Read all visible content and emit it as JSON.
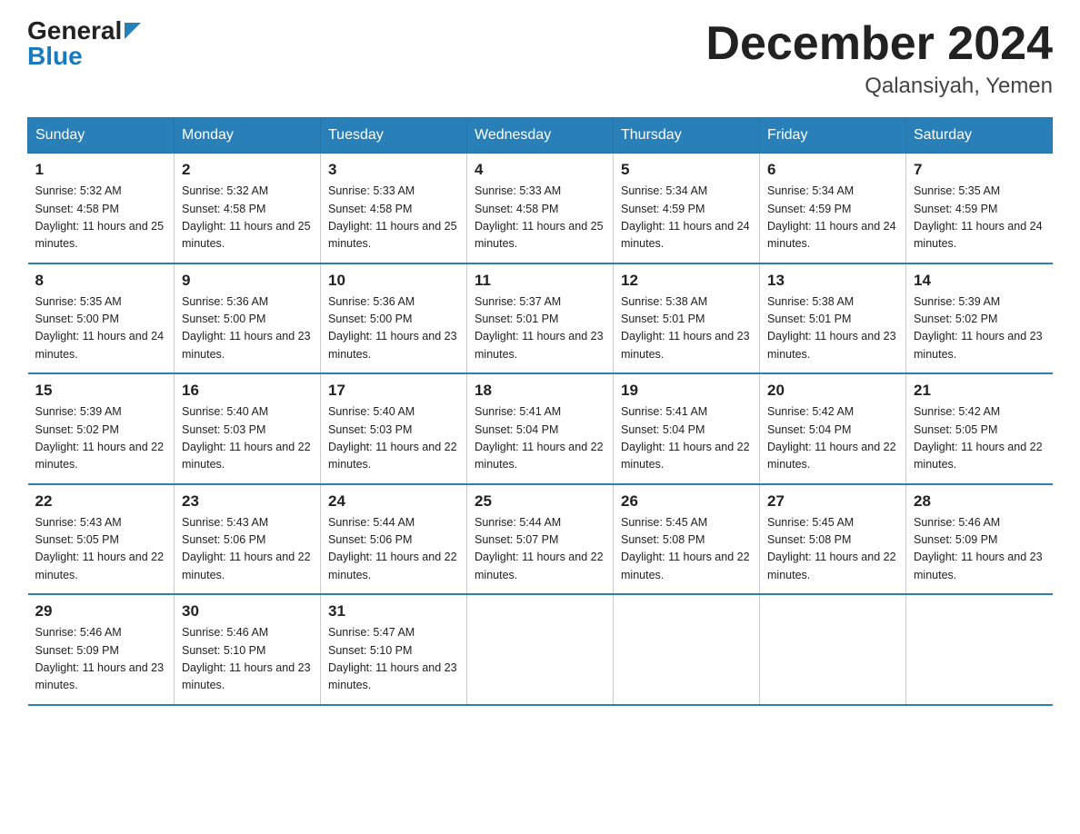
{
  "header": {
    "logo_general": "General",
    "logo_blue": "Blue",
    "month_title": "December 2024",
    "location": "Qalansiyah, Yemen"
  },
  "days_of_week": [
    "Sunday",
    "Monday",
    "Tuesday",
    "Wednesday",
    "Thursday",
    "Friday",
    "Saturday"
  ],
  "weeks": [
    [
      {
        "day": "1",
        "sunrise": "5:32 AM",
        "sunset": "4:58 PM",
        "daylight": "11 hours and 25 minutes."
      },
      {
        "day": "2",
        "sunrise": "5:32 AM",
        "sunset": "4:58 PM",
        "daylight": "11 hours and 25 minutes."
      },
      {
        "day": "3",
        "sunrise": "5:33 AM",
        "sunset": "4:58 PM",
        "daylight": "11 hours and 25 minutes."
      },
      {
        "day": "4",
        "sunrise": "5:33 AM",
        "sunset": "4:58 PM",
        "daylight": "11 hours and 25 minutes."
      },
      {
        "day": "5",
        "sunrise": "5:34 AM",
        "sunset": "4:59 PM",
        "daylight": "11 hours and 24 minutes."
      },
      {
        "day": "6",
        "sunrise": "5:34 AM",
        "sunset": "4:59 PM",
        "daylight": "11 hours and 24 minutes."
      },
      {
        "day": "7",
        "sunrise": "5:35 AM",
        "sunset": "4:59 PM",
        "daylight": "11 hours and 24 minutes."
      }
    ],
    [
      {
        "day": "8",
        "sunrise": "5:35 AM",
        "sunset": "5:00 PM",
        "daylight": "11 hours and 24 minutes."
      },
      {
        "day": "9",
        "sunrise": "5:36 AM",
        "sunset": "5:00 PM",
        "daylight": "11 hours and 23 minutes."
      },
      {
        "day": "10",
        "sunrise": "5:36 AM",
        "sunset": "5:00 PM",
        "daylight": "11 hours and 23 minutes."
      },
      {
        "day": "11",
        "sunrise": "5:37 AM",
        "sunset": "5:01 PM",
        "daylight": "11 hours and 23 minutes."
      },
      {
        "day": "12",
        "sunrise": "5:38 AM",
        "sunset": "5:01 PM",
        "daylight": "11 hours and 23 minutes."
      },
      {
        "day": "13",
        "sunrise": "5:38 AM",
        "sunset": "5:01 PM",
        "daylight": "11 hours and 23 minutes."
      },
      {
        "day": "14",
        "sunrise": "5:39 AM",
        "sunset": "5:02 PM",
        "daylight": "11 hours and 23 minutes."
      }
    ],
    [
      {
        "day": "15",
        "sunrise": "5:39 AM",
        "sunset": "5:02 PM",
        "daylight": "11 hours and 22 minutes."
      },
      {
        "day": "16",
        "sunrise": "5:40 AM",
        "sunset": "5:03 PM",
        "daylight": "11 hours and 22 minutes."
      },
      {
        "day": "17",
        "sunrise": "5:40 AM",
        "sunset": "5:03 PM",
        "daylight": "11 hours and 22 minutes."
      },
      {
        "day": "18",
        "sunrise": "5:41 AM",
        "sunset": "5:04 PM",
        "daylight": "11 hours and 22 minutes."
      },
      {
        "day": "19",
        "sunrise": "5:41 AM",
        "sunset": "5:04 PM",
        "daylight": "11 hours and 22 minutes."
      },
      {
        "day": "20",
        "sunrise": "5:42 AM",
        "sunset": "5:04 PM",
        "daylight": "11 hours and 22 minutes."
      },
      {
        "day": "21",
        "sunrise": "5:42 AM",
        "sunset": "5:05 PM",
        "daylight": "11 hours and 22 minutes."
      }
    ],
    [
      {
        "day": "22",
        "sunrise": "5:43 AM",
        "sunset": "5:05 PM",
        "daylight": "11 hours and 22 minutes."
      },
      {
        "day": "23",
        "sunrise": "5:43 AM",
        "sunset": "5:06 PM",
        "daylight": "11 hours and 22 minutes."
      },
      {
        "day": "24",
        "sunrise": "5:44 AM",
        "sunset": "5:06 PM",
        "daylight": "11 hours and 22 minutes."
      },
      {
        "day": "25",
        "sunrise": "5:44 AM",
        "sunset": "5:07 PM",
        "daylight": "11 hours and 22 minutes."
      },
      {
        "day": "26",
        "sunrise": "5:45 AM",
        "sunset": "5:08 PM",
        "daylight": "11 hours and 22 minutes."
      },
      {
        "day": "27",
        "sunrise": "5:45 AM",
        "sunset": "5:08 PM",
        "daylight": "11 hours and 22 minutes."
      },
      {
        "day": "28",
        "sunrise": "5:46 AM",
        "sunset": "5:09 PM",
        "daylight": "11 hours and 23 minutes."
      }
    ],
    [
      {
        "day": "29",
        "sunrise": "5:46 AM",
        "sunset": "5:09 PM",
        "daylight": "11 hours and 23 minutes."
      },
      {
        "day": "30",
        "sunrise": "5:46 AM",
        "sunset": "5:10 PM",
        "daylight": "11 hours and 23 minutes."
      },
      {
        "day": "31",
        "sunrise": "5:47 AM",
        "sunset": "5:10 PM",
        "daylight": "11 hours and 23 minutes."
      },
      null,
      null,
      null,
      null
    ]
  ]
}
